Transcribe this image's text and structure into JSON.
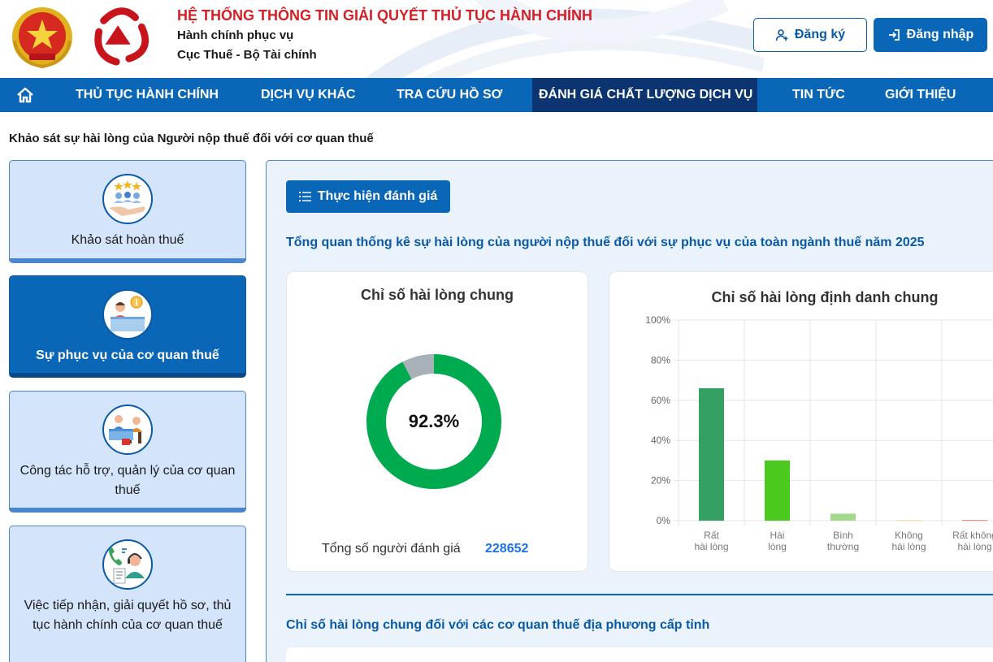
{
  "header": {
    "title": "HỆ THỐNG THÔNG TIN GIẢI QUYẾT THỦ TỤC HÀNH CHÍNH",
    "subtitle_1": "Hành chính phục vụ",
    "subtitle_2": "Cục Thuế - Bộ Tài chính",
    "register_label": "Đăng ký",
    "login_label": "Đăng nhập"
  },
  "nav": {
    "home_icon": "home-icon",
    "items": [
      {
        "label": "THỦ TỤC HÀNH CHÍNH"
      },
      {
        "label": "DỊCH VỤ KHÁC"
      },
      {
        "label": "TRA CỨU HỒ SƠ"
      },
      {
        "label": "ĐÁNH GIÁ CHẤT LƯỢNG DỊCH VỤ",
        "active": true
      },
      {
        "label": "TIN TỨC"
      },
      {
        "label": "GIỚI THIỆU"
      }
    ]
  },
  "page_title": "Khảo sát sự hài lòng của Người nộp thuế đối với cơ quan thuế",
  "sidebar": {
    "items": [
      {
        "label": "Khảo sát hoàn thuế",
        "icon": "survey-rating-icon"
      },
      {
        "label": "Sự phục vụ của cơ quan thuế",
        "icon": "service-desk-icon",
        "active": true
      },
      {
        "label": "Công tác hỗ trợ, quản lý của cơ quan thuế",
        "icon": "support-counter-icon"
      },
      {
        "label": "Việc tiếp nhận, giải quyết hồ sơ, thủ tục hành chính của cơ quan thuế",
        "icon": "call-center-icon"
      }
    ]
  },
  "main": {
    "evaluate_button": "Thực hiện đánh giá",
    "overview_title": "Tổng quan thống kê sự hài lòng của người nộp thuế đối với sự phục vụ của toàn ngành thuế năm 2025",
    "donut_card": {
      "title": "Chỉ số hài lòng chung",
      "center_label": "92.3%",
      "total_label": "Tổng số người đánh giá",
      "total_value": "228652"
    },
    "bar_card": {
      "title": "Chỉ số hài lòng định danh chung"
    },
    "province_title": "Chỉ số hài lòng chung đối với các cơ quan thuế địa phương cấp tỉnh"
  },
  "colors": {
    "brand_blue": "#0a66b7",
    "nav_active": "#0b3470",
    "title_red": "#d32027",
    "donut_green": "#00aa4f",
    "donut_grey": "#a9b1b8"
  },
  "chart_data": [
    {
      "type": "pie",
      "title": "Chỉ số hài lòng chung",
      "values": [
        92.3,
        7.7
      ],
      "colors": [
        "#00aa4f",
        "#a9b1b8"
      ],
      "center_label": "92.3%"
    },
    {
      "type": "bar",
      "title": "Chỉ số hài lòng định danh chung",
      "categories": [
        [
          "Rất",
          "hài lòng"
        ],
        [
          "Hài",
          "lòng"
        ],
        [
          "Bình",
          "thường"
        ],
        [
          "Không",
          "hài lòng"
        ],
        [
          "Rất không",
          "hài lòng"
        ]
      ],
      "values": [
        66,
        30,
        3.5,
        0.3,
        0.4
      ],
      "colors": [
        "#34a062",
        "#4cc91f",
        "#a3d98a",
        "#f1d49a",
        "#ee8a80"
      ],
      "ylim": [
        0,
        100
      ],
      "yticks": [
        "0%",
        "20%",
        "40%",
        "60%",
        "80%",
        "100%"
      ],
      "grid": true
    }
  ]
}
